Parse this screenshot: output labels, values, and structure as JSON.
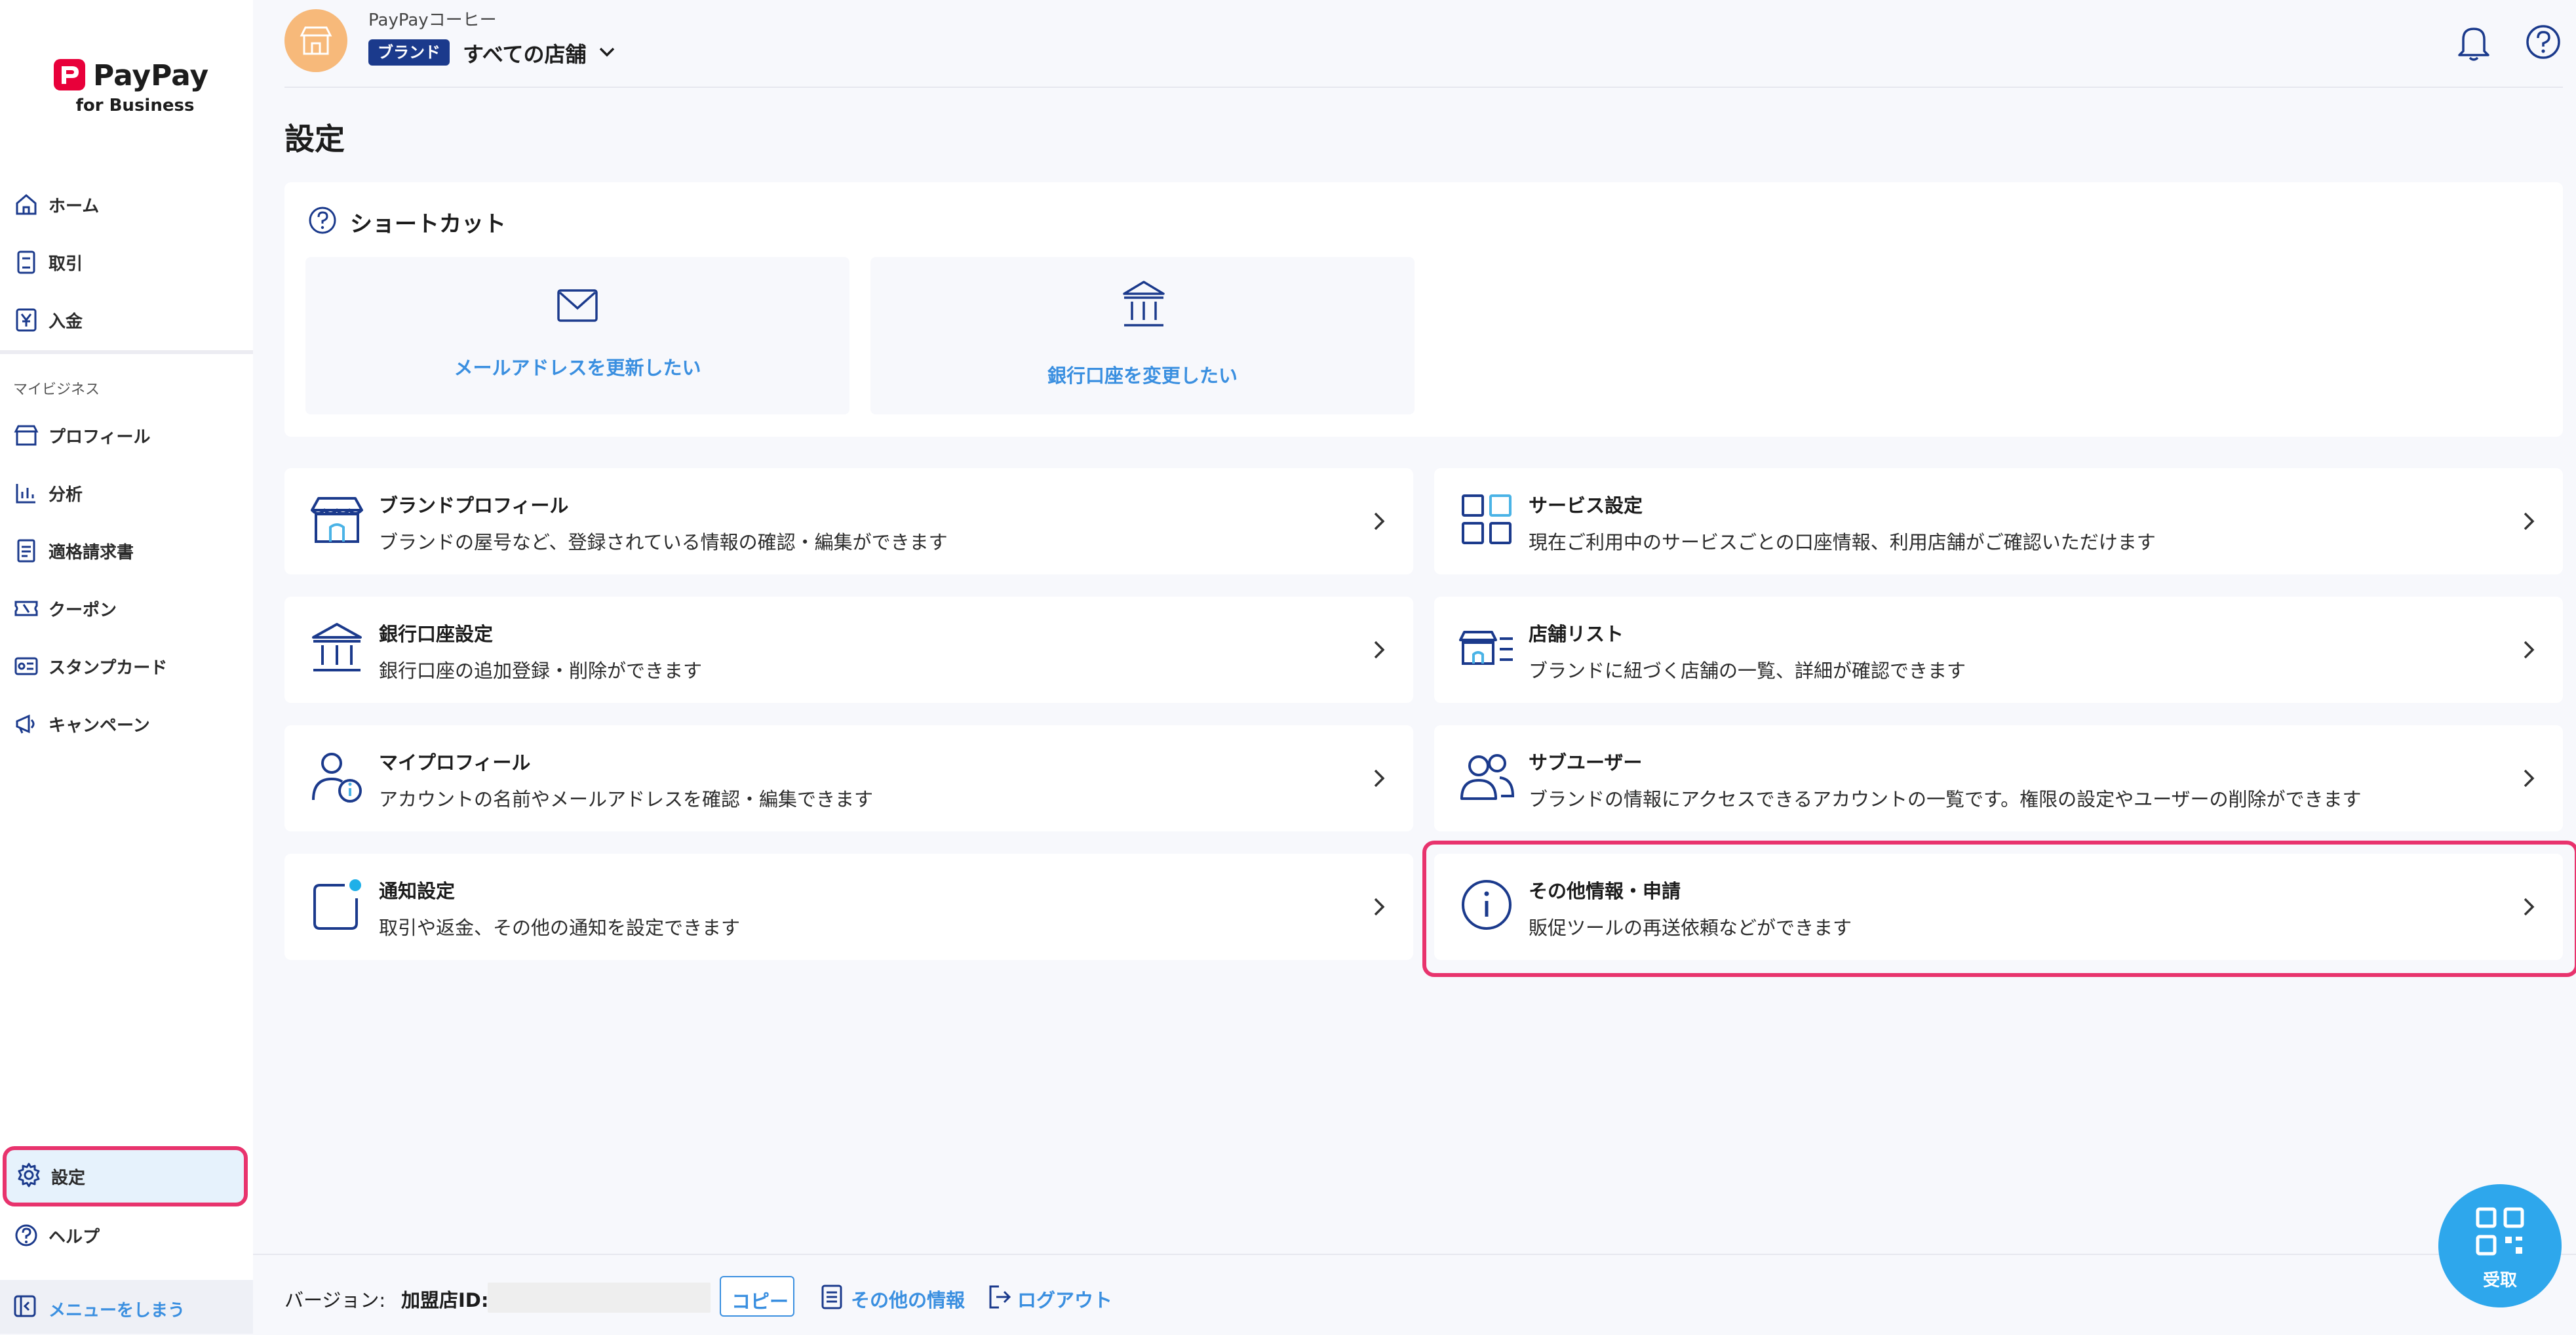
{
  "brand": {
    "logo_text": "PayPay",
    "logo_sub": "for Business",
    "colors": {
      "brand_red": "#e8003a",
      "accent_blue": "#3a8fe0",
      "navy": "#1b3a8c",
      "highlight": "#e8336d"
    }
  },
  "sidebar": {
    "items": [
      {
        "label": "ホーム",
        "icon": "home-icon"
      },
      {
        "label": "取引",
        "icon": "receipt-icon"
      },
      {
        "label": "入金",
        "icon": "yen-icon"
      }
    ],
    "section_label": "マイビジネス",
    "business_items": [
      {
        "label": "プロフィール",
        "icon": "store-icon"
      },
      {
        "label": "分析",
        "icon": "chart-icon"
      },
      {
        "label": "適格請求書",
        "icon": "invoice-icon"
      },
      {
        "label": "クーポン",
        "icon": "coupon-icon"
      },
      {
        "label": "スタンプカード",
        "icon": "stamp-card-icon"
      },
      {
        "label": "キャンペーン",
        "icon": "megaphone-icon"
      }
    ],
    "bottom_items": [
      {
        "label": "設定",
        "icon": "gear-icon",
        "active": true
      },
      {
        "label": "ヘルプ",
        "icon": "help-icon"
      }
    ],
    "collapse_label": "メニューをしまう"
  },
  "header": {
    "shop_name": "PayPayコーヒー",
    "badge": "ブランド",
    "store_selector": "すべての店舗",
    "page_title": "設定"
  },
  "shortcuts": {
    "title": "ショートカット",
    "tiles": [
      {
        "label": "メールアドレスを更新したい",
        "icon": "mail-icon"
      },
      {
        "label": "銀行口座を変更したい",
        "icon": "bank-icon"
      }
    ]
  },
  "settings": [
    {
      "title": "ブランドプロフィール",
      "desc": "ブランドの屋号など、登録されている情報の確認・編集ができます",
      "icon": "store-icon"
    },
    {
      "title": "サービス設定",
      "desc": "現在ご利用中のサービスごとの口座情報、利用店舗がご確認いただけます",
      "icon": "grid-icon"
    },
    {
      "title": "銀行口座設定",
      "desc": "銀行口座の追加登録・削除ができます",
      "icon": "bank-icon"
    },
    {
      "title": "店舗リスト",
      "desc": "ブランドに紐づく店舗の一覧、詳細が確認できます",
      "icon": "store-list-icon"
    },
    {
      "title": "マイプロフィール",
      "desc": "アカウントの名前やメールアドレスを確認・編集できます",
      "icon": "user-info-icon"
    },
    {
      "title": "サブユーザー",
      "desc": "ブランドの情報にアクセスできるアカウントの一覧です。権限の設定やユーザーの削除ができます",
      "icon": "users-icon"
    },
    {
      "title": "通知設定",
      "desc": "取引や返金、その他の通知を設定できます",
      "icon": "notification-icon"
    },
    {
      "title": "その他情報・申請",
      "desc": "販促ツールの再送依頼などができます",
      "icon": "info-icon"
    }
  ],
  "footer": {
    "version_label": "バージョン:",
    "merchant_id_label": "加盟店ID:",
    "copy_label": "コピー",
    "other_info_label": "その他の情報",
    "logout_label": "ログアウト"
  },
  "fab": {
    "label": "受取",
    "icon": "qr-icon"
  }
}
